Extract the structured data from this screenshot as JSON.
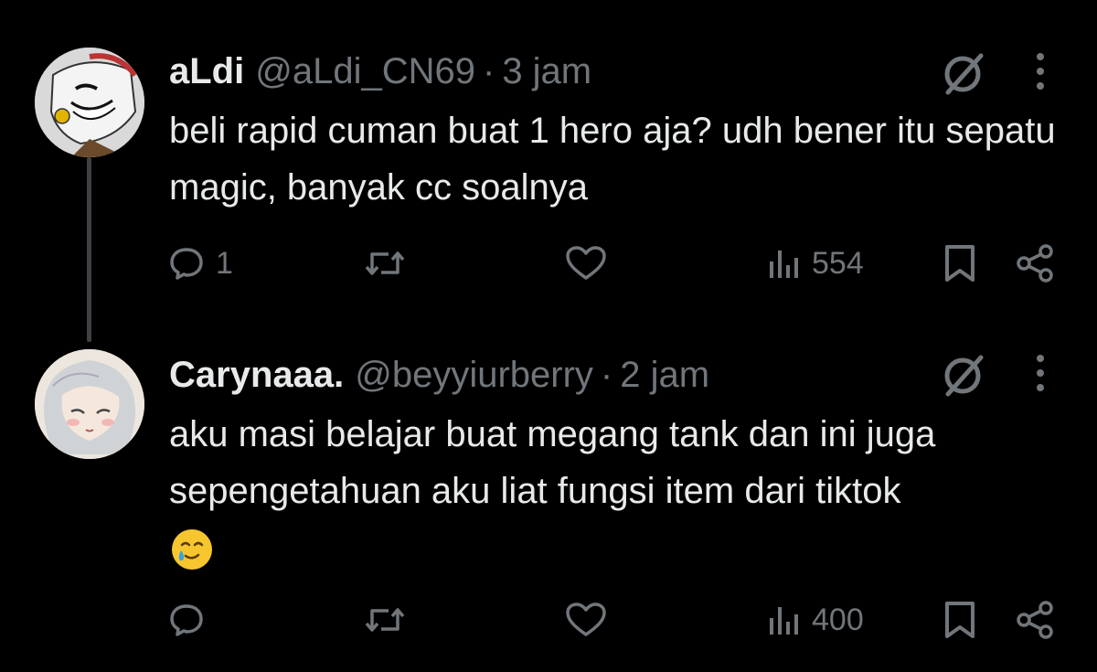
{
  "tweets": [
    {
      "display_name": "aLdi",
      "handle": "@aLdi_CN69",
      "separator": "·",
      "time": "3 jam",
      "text": "beli rapid cuman buat 1 hero aja? udh bener itu sepatu magic, banyak cc soalnya",
      "replies": "1",
      "views": "554",
      "avatar_icon": "avatar-anime-character-icon"
    },
    {
      "display_name": "Carynaaa.",
      "handle": "@beyyiurberry",
      "separator": "·",
      "time": "2 jam",
      "text": "aku masi belajar buat megang tank dan ini juga sepengetahuan aku liat fungsi item dari tiktok",
      "emoji_icon": "smiling-face-with-tear-icon",
      "replies": "",
      "views": "400",
      "avatar_icon": "avatar-anime-girl-icon"
    }
  ],
  "icons": {
    "grok": "grok-icon",
    "more": "more-vertical-icon",
    "reply": "reply-icon",
    "retweet": "retweet-icon",
    "like": "like-heart-icon",
    "views": "views-chart-icon",
    "bookmark": "bookmark-icon",
    "share": "share-icon"
  },
  "colors": {
    "background": "#000000",
    "primary_text": "#e7e9ea",
    "secondary_text": "#71767b",
    "thread_line": "#3e4144"
  }
}
